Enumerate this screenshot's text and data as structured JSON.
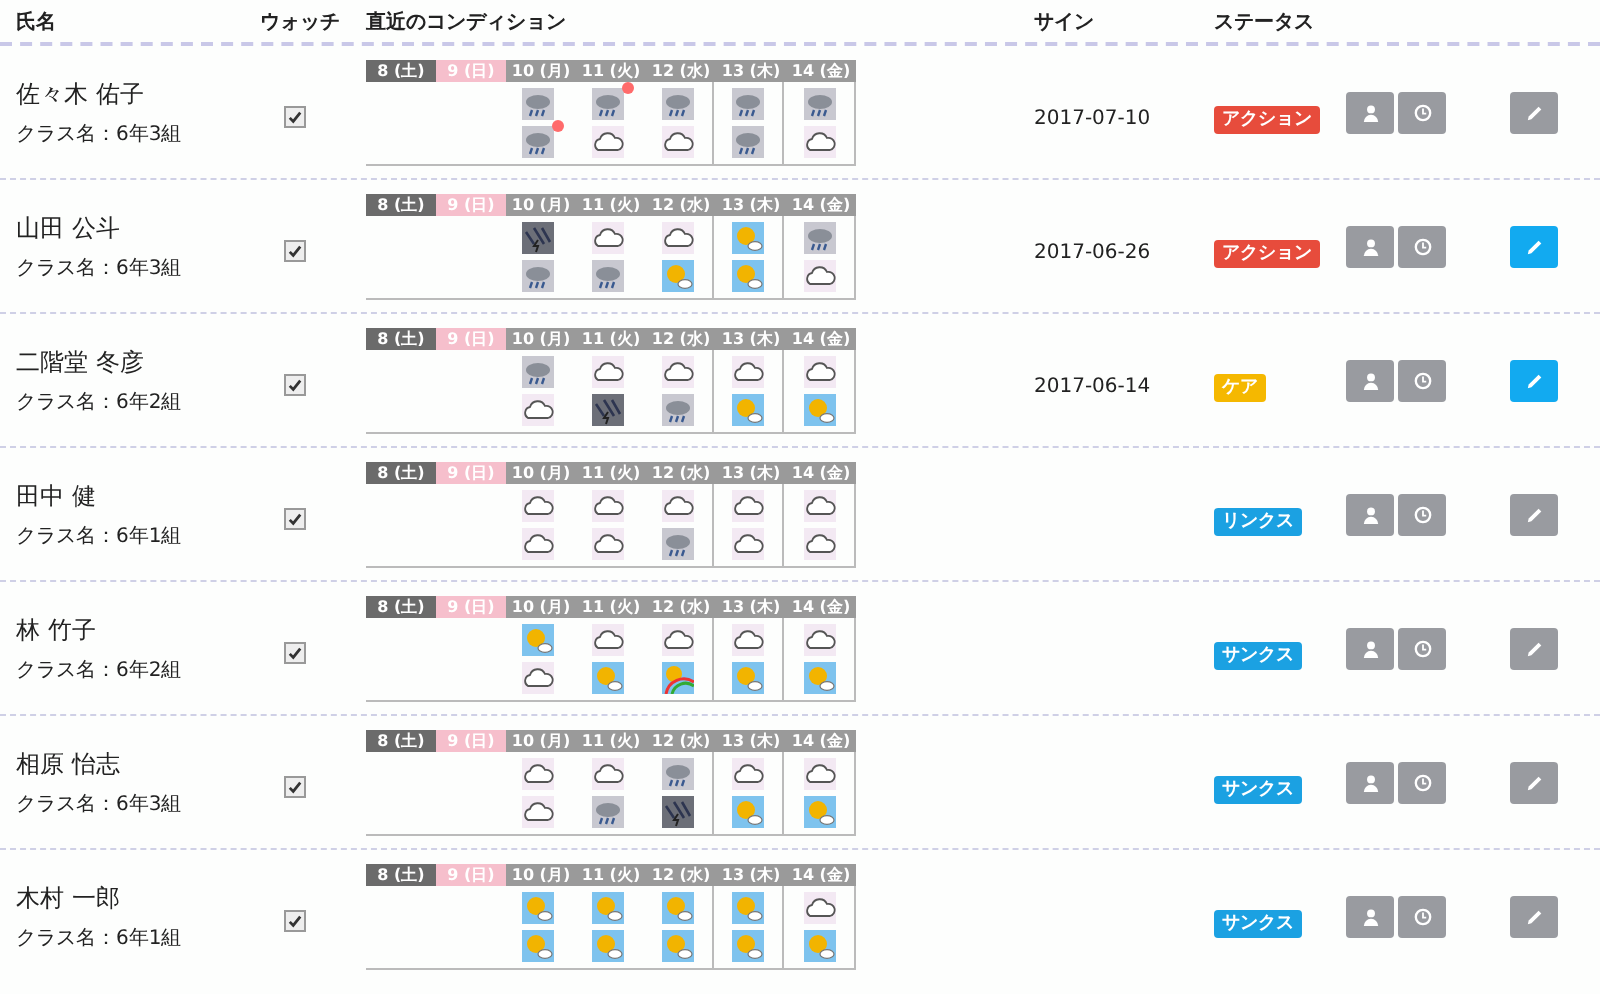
{
  "columns": [
    "氏名",
    "ウォッチ",
    "直近のコンディション",
    "サイン",
    "ステータス"
  ],
  "rows": [
    {
      "name": "佐々木 佑子",
      "class": "クラス名：6年3組",
      "watch": true,
      "days": [
        {
          "label": "8 (土)",
          "kind": "sat"
        },
        {
          "label": "9 (日)",
          "kind": "sun"
        },
        {
          "label": "10 (月)",
          "kind": "weekday"
        },
        {
          "label": "11 (火)",
          "kind": "weekday"
        },
        {
          "label": "12 (水)",
          "kind": "weekday"
        },
        {
          "label": "13 (木)",
          "kind": "weekday"
        },
        {
          "label": "14 (金)",
          "kind": "weekday"
        }
      ],
      "weather": [
        [
          {
            "kind": "rain",
            "alert": false
          },
          {
            "kind": "rain",
            "alert": true
          },
          {
            "kind": "rain",
            "alert": false
          },
          {
            "kind": "rain",
            "alert": false
          },
          {
            "kind": "rain",
            "alert": false
          }
        ],
        [
          {
            "kind": "rain",
            "alert": true
          },
          {
            "kind": "cloud",
            "alert": false
          },
          {
            "kind": "cloud",
            "alert": false
          },
          {
            "kind": "rain",
            "alert": false
          },
          {
            "kind": "cloud",
            "alert": false
          }
        ]
      ],
      "sign": "2017-07-10",
      "status": {
        "label": "アクション",
        "color": "#e74c3c"
      },
      "edit_highlighted": false
    },
    {
      "name": "山田 公斗",
      "class": "クラス名：6年3組",
      "watch": true,
      "days": [
        {
          "label": "8 (土)",
          "kind": "sat"
        },
        {
          "label": "9 (日)",
          "kind": "sun"
        },
        {
          "label": "10 (月)",
          "kind": "weekday"
        },
        {
          "label": "11 (火)",
          "kind": "weekday"
        },
        {
          "label": "12 (水)",
          "kind": "weekday"
        },
        {
          "label": "13 (木)",
          "kind": "weekday"
        },
        {
          "label": "14 (金)",
          "kind": "weekday"
        }
      ],
      "weather": [
        [
          {
            "kind": "storm",
            "alert": false
          },
          {
            "kind": "cloud",
            "alert": false
          },
          {
            "kind": "cloud",
            "alert": false
          },
          {
            "kind": "sun",
            "alert": false
          },
          {
            "kind": "rain",
            "alert": false
          }
        ],
        [
          {
            "kind": "rain",
            "alert": false
          },
          {
            "kind": "rain",
            "alert": false
          },
          {
            "kind": "sun",
            "alert": false
          },
          {
            "kind": "sun",
            "alert": false
          },
          {
            "kind": "cloud",
            "alert": false
          }
        ]
      ],
      "sign": "2017-06-26",
      "status": {
        "label": "アクション",
        "color": "#e74c3c"
      },
      "edit_highlighted": true
    },
    {
      "name": "二階堂 冬彦",
      "class": "クラス名：6年2組",
      "watch": true,
      "days": [
        {
          "label": "8 (土)",
          "kind": "sat"
        },
        {
          "label": "9 (日)",
          "kind": "sun"
        },
        {
          "label": "10 (月)",
          "kind": "weekday"
        },
        {
          "label": "11 (火)",
          "kind": "weekday"
        },
        {
          "label": "12 (水)",
          "kind": "weekday"
        },
        {
          "label": "13 (木)",
          "kind": "weekday"
        },
        {
          "label": "14 (金)",
          "kind": "weekday"
        }
      ],
      "weather": [
        [
          {
            "kind": "rain",
            "alert": false
          },
          {
            "kind": "cloud",
            "alert": false
          },
          {
            "kind": "cloud",
            "alert": false
          },
          {
            "kind": "cloud",
            "alert": false
          },
          {
            "kind": "cloud",
            "alert": false
          }
        ],
        [
          {
            "kind": "cloud",
            "alert": false
          },
          {
            "kind": "storm",
            "alert": false
          },
          {
            "kind": "rain",
            "alert": false
          },
          {
            "kind": "sun",
            "alert": false
          },
          {
            "kind": "sun",
            "alert": false
          }
        ]
      ],
      "sign": "2017-06-14",
      "status": {
        "label": "ケア",
        "color": "#f5b800"
      },
      "edit_highlighted": true
    },
    {
      "name": "田中 健",
      "class": "クラス名：6年1組",
      "watch": true,
      "days": [
        {
          "label": "8 (土)",
          "kind": "sat"
        },
        {
          "label": "9 (日)",
          "kind": "sun"
        },
        {
          "label": "10 (月)",
          "kind": "weekday"
        },
        {
          "label": "11 (火)",
          "kind": "weekday"
        },
        {
          "label": "12 (水)",
          "kind": "weekday"
        },
        {
          "label": "13 (木)",
          "kind": "weekday"
        },
        {
          "label": "14 (金)",
          "kind": "weekday"
        }
      ],
      "weather": [
        [
          {
            "kind": "cloud",
            "alert": false
          },
          {
            "kind": "cloud",
            "alert": false
          },
          {
            "kind": "cloud",
            "alert": false
          },
          {
            "kind": "cloud",
            "alert": false
          },
          {
            "kind": "cloud",
            "alert": false
          }
        ],
        [
          {
            "kind": "cloud",
            "alert": false
          },
          {
            "kind": "cloud",
            "alert": false
          },
          {
            "kind": "rain",
            "alert": false
          },
          {
            "kind": "cloud",
            "alert": false
          },
          {
            "kind": "cloud",
            "alert": false
          }
        ]
      ],
      "status": {
        "label": "リンクス",
        "color": "#1ba1e2"
      },
      "edit_highlighted": false
    },
    {
      "name": "林 竹子",
      "class": "クラス名：6年2組",
      "watch": true,
      "days": [
        {
          "label": "8 (土)",
          "kind": "sat"
        },
        {
          "label": "9 (日)",
          "kind": "sun"
        },
        {
          "label": "10 (月)",
          "kind": "weekday"
        },
        {
          "label": "11 (火)",
          "kind": "weekday"
        },
        {
          "label": "12 (水)",
          "kind": "weekday"
        },
        {
          "label": "13 (木)",
          "kind": "weekday"
        },
        {
          "label": "14 (金)",
          "kind": "weekday"
        }
      ],
      "weather": [
        [
          {
            "kind": "sun",
            "alert": false
          },
          {
            "kind": "cloud",
            "alert": false
          },
          {
            "kind": "cloud",
            "alert": false
          },
          {
            "kind": "cloud",
            "alert": false
          },
          {
            "kind": "cloud",
            "alert": false
          }
        ],
        [
          {
            "kind": "cloud",
            "alert": false
          },
          {
            "kind": "sun",
            "alert": false
          },
          {
            "kind": "rainbow",
            "alert": false
          },
          {
            "kind": "sun",
            "alert": false
          },
          {
            "kind": "sun",
            "alert": false
          }
        ]
      ],
      "status": {
        "label": "サンクス",
        "color": "#1ba1e2"
      },
      "edit_highlighted": false
    },
    {
      "name": "相原 怡志",
      "class": "クラス名：6年3組",
      "watch": true,
      "days": [
        {
          "label": "8 (土)",
          "kind": "sat"
        },
        {
          "label": "9 (日)",
          "kind": "sun"
        },
        {
          "label": "10 (月)",
          "kind": "weekday"
        },
        {
          "label": "11 (火)",
          "kind": "weekday"
        },
        {
          "label": "12 (水)",
          "kind": "weekday"
        },
        {
          "label": "13 (木)",
          "kind": "weekday"
        },
        {
          "label": "14 (金)",
          "kind": "weekday"
        }
      ],
      "weather": [
        [
          {
            "kind": "cloud",
            "alert": false
          },
          {
            "kind": "cloud",
            "alert": false
          },
          {
            "kind": "rain",
            "alert": false
          },
          {
            "kind": "cloud",
            "alert": false
          },
          {
            "kind": "cloud",
            "alert": false
          }
        ],
        [
          {
            "kind": "cloud",
            "alert": false
          },
          {
            "kind": "rain",
            "alert": false
          },
          {
            "kind": "storm",
            "alert": false
          },
          {
            "kind": "sun",
            "alert": false
          },
          {
            "kind": "sun",
            "alert": false
          }
        ]
      ],
      "status": {
        "label": "サンクス",
        "color": "#1ba1e2"
      },
      "edit_highlighted": false
    },
    {
      "name": "木村 一郎",
      "class": "クラス名：6年1組",
      "watch": true,
      "days": [
        {
          "label": "8 (土)",
          "kind": "sat"
        },
        {
          "label": "9 (日)",
          "kind": "sun"
        },
        {
          "label": "10 (月)",
          "kind": "weekday"
        },
        {
          "label": "11 (火)",
          "kind": "weekday"
        },
        {
          "label": "12 (水)",
          "kind": "weekday"
        },
        {
          "label": "13 (木)",
          "kind": "weekday"
        },
        {
          "label": "14 (金)",
          "kind": "weekday"
        }
      ],
      "weather": [
        [
          {
            "kind": "sun",
            "alert": false
          },
          {
            "kind": "sun",
            "alert": false
          },
          {
            "kind": "sun",
            "alert": false
          },
          {
            "kind": "sun",
            "alert": false
          },
          {
            "kind": "cloud",
            "alert": false
          }
        ],
        [
          {
            "kind": "sun",
            "alert": false
          },
          {
            "kind": "sun",
            "alert": false
          },
          {
            "kind": "sun",
            "alert": false
          },
          {
            "kind": "sun",
            "alert": false
          },
          {
            "kind": "sun",
            "alert": false
          }
        ]
      ],
      "status": {
        "label": "サンクス",
        "color": "#1ba1e2"
      },
      "edit_highlighted": false
    }
  ]
}
